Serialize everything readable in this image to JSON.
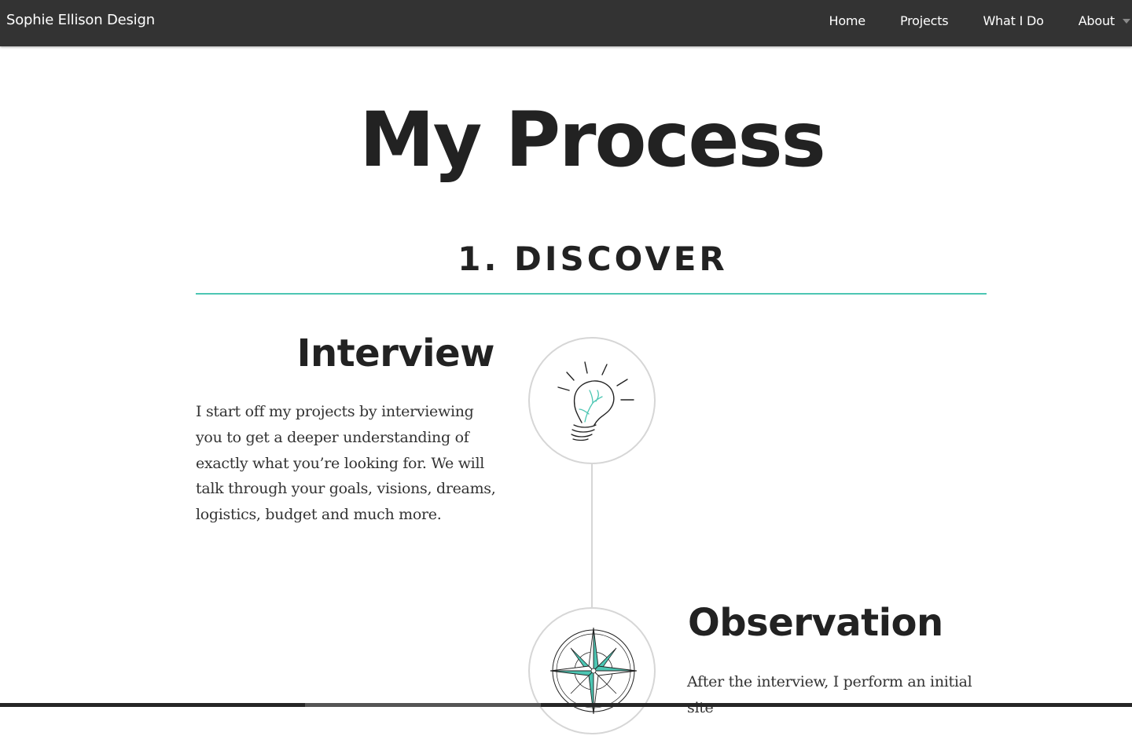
{
  "navbar": {
    "brand": "Sophie Ellison Design",
    "items": [
      {
        "label": "Home"
      },
      {
        "label": "Projects"
      },
      {
        "label": "What I Do"
      },
      {
        "label": "About"
      }
    ],
    "background": "#333333"
  },
  "page": {
    "title": "My Process",
    "step": {
      "heading": "1. DISCOVER",
      "rule_color": "#4cc6b3"
    },
    "sections": [
      {
        "title": "Interview",
        "icon": "lightbulb-icon",
        "text": "I start off my projects by interviewing you to get a deeper understanding of exactly what you’re looking for. We will talk through your goals, visions, dreams, logistics, budget and much more."
      },
      {
        "title": "Observation",
        "icon": "compass-rose-icon",
        "text": "After the interview, I perform an initial site"
      }
    ],
    "accent_color": "#4cc6b3"
  }
}
